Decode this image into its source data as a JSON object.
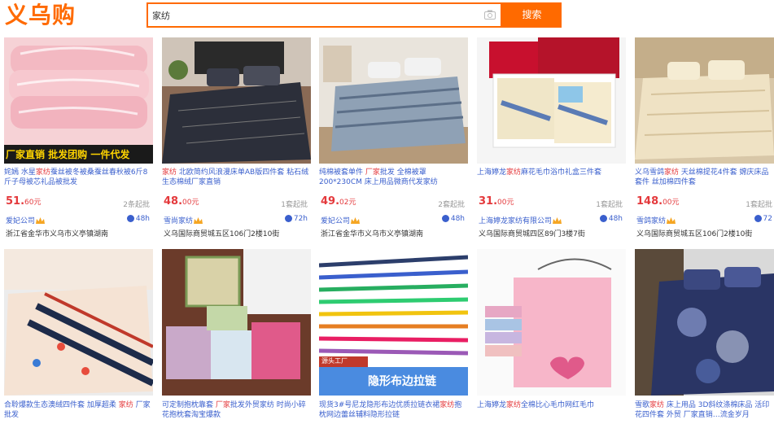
{
  "header": {
    "logo": "义乌购",
    "search_value": "家纺",
    "search_button": "搜索"
  },
  "colors": {
    "accent": "#ff6a00",
    "link": "#3a5fcd",
    "price": "#e4393c"
  },
  "row1": [
    {
      "title_pre": "姹嫣 水星",
      "title_hl": "家纺",
      "title_post": "蚕丝被冬被桑蚕丝春秋被6斤8斤子母被芯礼品被批发",
      "price_int": "51.",
      "price_dec": "60",
      "price_unit": "元",
      "moq": "2条起批",
      "company": "爱妃公司",
      "resp": "48h",
      "addr": "浙江省金华市义乌市义亭镇湖南",
      "img_caption": "厂家直销 批发团购 一件代发"
    },
    {
      "title_pre": "",
      "title_hl": "家纺",
      "title_post": " 北欧简约风浪漫床单AB版四件套 粘石绒生态棉绒厂家直销",
      "price_int": "48.",
      "price_dec": "00",
      "price_unit": "元",
      "moq": "1套起批",
      "company": "雪尚家纺",
      "resp": "72h",
      "addr": "义乌国际商贸城五区106门2楼10街"
    },
    {
      "title_pre": "纯棉被套单件 ",
      "title_hl": "厂家",
      "title_post": "批发 全棉被罩200*230CM 床上用品微商代发家纺",
      "price_int": "49.",
      "price_dec": "02",
      "price_unit": "元",
      "moq": "2套起批",
      "company": "爱妃公司",
      "resp": "48h",
      "addr": "浙江省金华市义乌市义亭镇湖南"
    },
    {
      "title_pre": "上海婷龙",
      "title_hl": "家纺",
      "title_post": "麻花毛巾浴巾礼盒三件套",
      "price_int": "31.",
      "price_dec": "00",
      "price_unit": "元",
      "moq": "1套起批",
      "company": "上海婷龙家纺有限公司",
      "resp": "48h",
      "addr": "义乌国际商贸城四区89门3楼7街"
    },
    {
      "title_pre": "义乌雪鸽",
      "title_hl": "家纺",
      "title_post": " 天丝棉提花4件套 嫦庆床品套件 丝加棉四件套",
      "price_int": "148.",
      "price_dec": "00",
      "price_unit": "元",
      "moq": "1套起批",
      "company": "雪鸽家纺",
      "resp": "72",
      "addr": "义乌国际商贸城五区106门2楼10街"
    }
  ],
  "row2": [
    {
      "title_pre": "合聆爆款生态澳绒四件套 加厚超柔 ",
      "title_hl": "家纺",
      "title_post": " 厂家批发"
    },
    {
      "title_pre": "可定制抱枕靠套 ",
      "title_hl": "厂家",
      "title_post": "批发外贸家纺 时尚小碎花抱枕套淘宝爆款"
    },
    {
      "title_pre": "现货3#号尼龙隐形布边优质拉链衣裙",
      "title_hl": "家纺",
      "title_post": "抱枕网边蕾丝辅料隐形拉链",
      "img_caption": "隐形布边拉链",
      "img_badge": "源头工厂"
    },
    {
      "title_pre": "上海婷龙",
      "title_hl": "家纺",
      "title_post": "全棉比心毛巾网红毛巾"
    },
    {
      "title_pre": "雪歌",
      "title_hl": "家纺",
      "title_post": " 床上用品 3D斜纹涤棉床品 活印花四件套 外贸 厂家直销…流金岁月"
    }
  ]
}
